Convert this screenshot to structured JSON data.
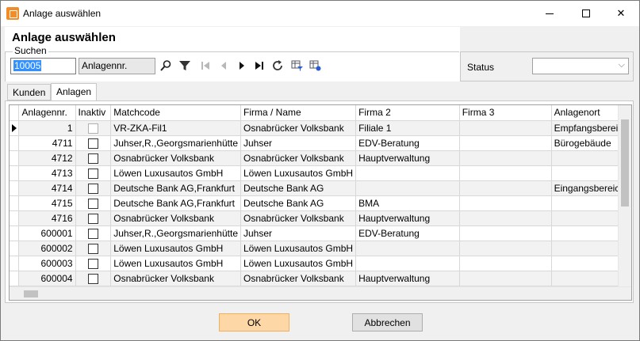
{
  "window": {
    "title": "Anlage auswählen"
  },
  "header": {
    "title": "Anlage auswählen"
  },
  "search": {
    "legend": "Suchen",
    "value": "10005",
    "field": "Anlagennr."
  },
  "status": {
    "label": "Status",
    "value": ""
  },
  "tabs": [
    {
      "label": "Kunden",
      "active": false
    },
    {
      "label": "Anlagen",
      "active": true
    }
  ],
  "grid": {
    "columns": [
      "Anlagennr.",
      "Inaktiv",
      "Matchcode",
      "Firma / Name",
      "Firma 2",
      "Firma 3",
      "Anlagenort"
    ],
    "rows": [
      {
        "nr": "1",
        "matchcode": "VR-ZKA-Fil1",
        "firma": "Osnabrücker Volksbank",
        "firma2": "Filiale 1",
        "firma3": "",
        "ort": "Empfangsbereich"
      },
      {
        "nr": "4711",
        "matchcode": "Juhser,R.,Georgsmarienhütte",
        "firma": "Juhser",
        "firma2": "EDV-Beratung",
        "firma3": "",
        "ort": "Bürogebäude"
      },
      {
        "nr": "4712",
        "matchcode": "Osnabrücker Volksbank",
        "firma": "Osnabrücker Volksbank",
        "firma2": "Hauptverwaltung",
        "firma3": "",
        "ort": ""
      },
      {
        "nr": "4713",
        "matchcode": "Löwen Luxusautos GmbH",
        "firma": "Löwen Luxusautos GmbH",
        "firma2": "",
        "firma3": "",
        "ort": ""
      },
      {
        "nr": "4714",
        "matchcode": "Deutsche Bank AG,Frankfurt",
        "firma": "Deutsche Bank AG",
        "firma2": "",
        "firma3": "",
        "ort": "Eingangsbereich"
      },
      {
        "nr": "4715",
        "matchcode": "Deutsche Bank AG,Frankfurt",
        "firma": "Deutsche Bank AG",
        "firma2": "BMA",
        "firma3": "",
        "ort": ""
      },
      {
        "nr": "4716",
        "matchcode": "Osnabrücker Volksbank",
        "firma": "Osnabrücker Volksbank",
        "firma2": "Hauptverwaltung",
        "firma3": "",
        "ort": ""
      },
      {
        "nr": "600001",
        "matchcode": "Juhser,R.,Georgsmarienhütte",
        "firma": "Juhser",
        "firma2": "EDV-Beratung",
        "firma3": "",
        "ort": ""
      },
      {
        "nr": "600002",
        "matchcode": "Löwen Luxusautos GmbH",
        "firma": "Löwen Luxusautos GmbH",
        "firma2": "",
        "firma3": "",
        "ort": ""
      },
      {
        "nr": "600003",
        "matchcode": "Löwen Luxusautos GmbH",
        "firma": "Löwen Luxusautos GmbH",
        "firma2": "",
        "firma3": "",
        "ort": ""
      },
      {
        "nr": "600004",
        "matchcode": "Osnabrücker Volksbank",
        "firma": "Osnabrücker Volksbank",
        "firma2": "Hauptverwaltung",
        "firma3": "",
        "ort": ""
      }
    ]
  },
  "buttons": {
    "ok": "OK",
    "cancel": "Abbrechen"
  },
  "colors": {
    "ok_bg": "#fdd7a6",
    "app_icon": "#f28c28"
  }
}
